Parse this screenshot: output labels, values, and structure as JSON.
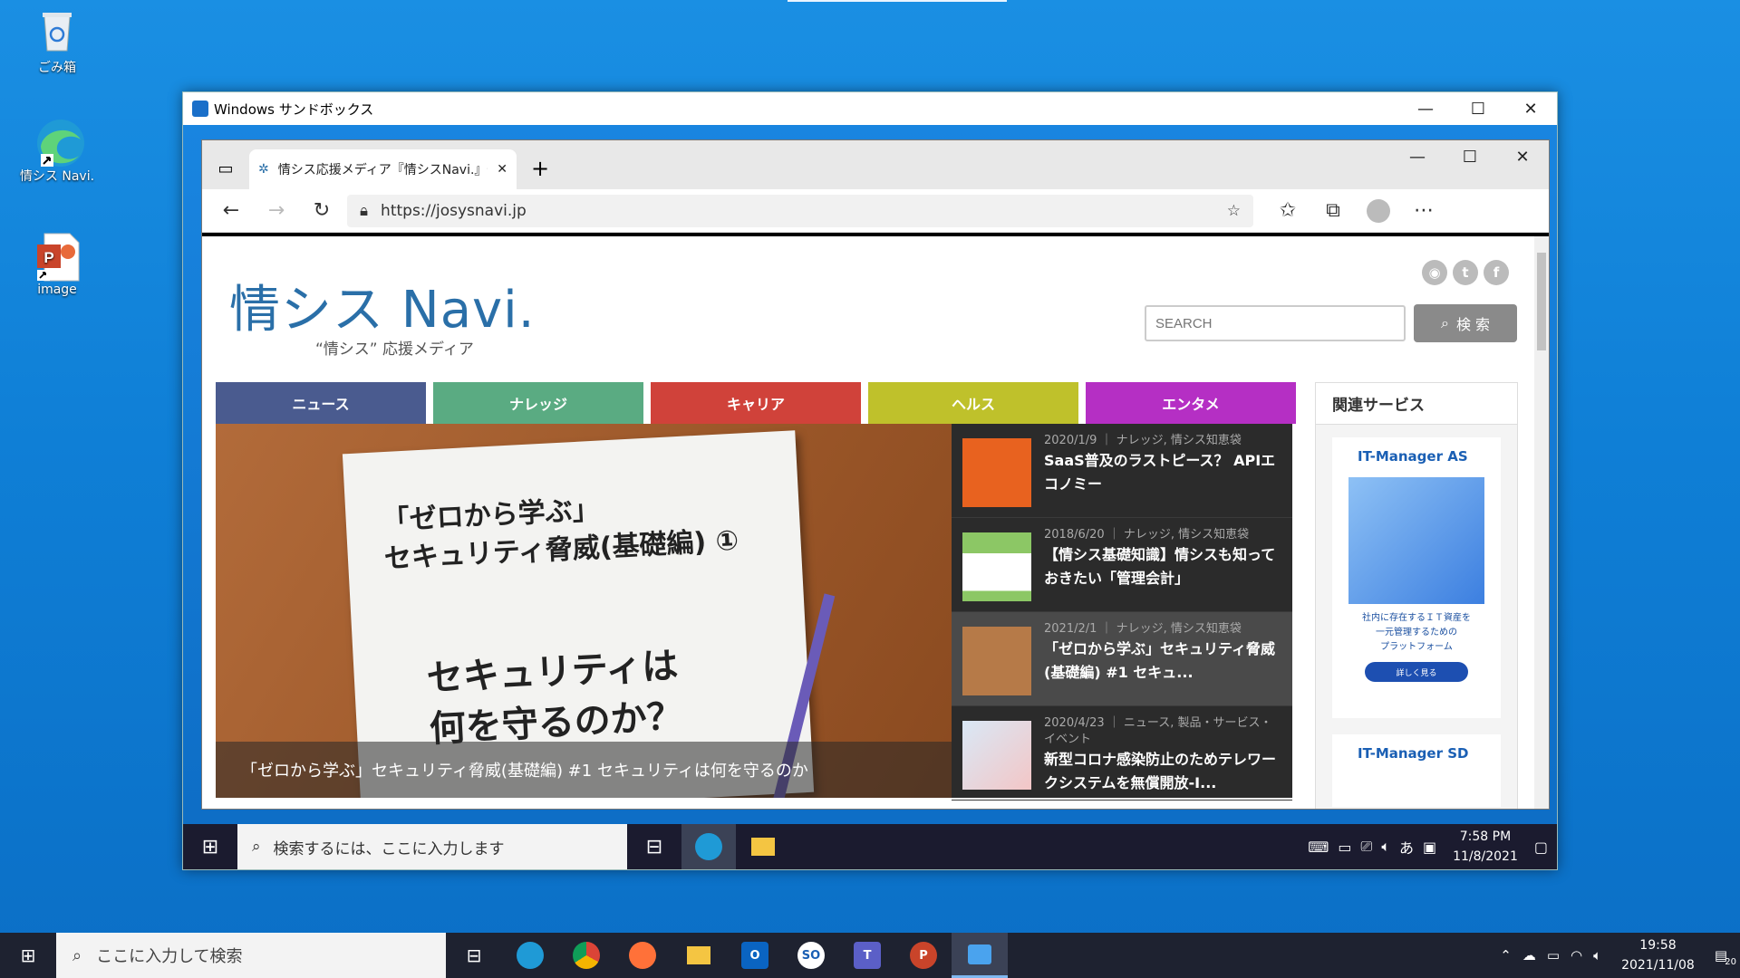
{
  "desktop": {
    "icons": [
      {
        "label": "ごみ箱"
      },
      {
        "label": "情シス Navi."
      },
      {
        "label": "image"
      }
    ]
  },
  "sandbox": {
    "title": "Windows サンドボックス",
    "edge": {
      "tab_title": "情シス応援メディア『情シスNavi.』情",
      "url": "https://josysnavi.jp"
    },
    "site": {
      "logo": "情シス Navi.",
      "tagline": "“情シス” 応援メディア",
      "search_placeholder": "SEARCH",
      "search_button": "検 索",
      "nav": [
        {
          "label": "ニュース",
          "color": "#4a5b8f"
        },
        {
          "label": "ナレッジ",
          "color": "#5aab82"
        },
        {
          "label": "キャリア",
          "color": "#d0423a"
        },
        {
          "label": "ヘルス",
          "color": "#bfc12b"
        },
        {
          "label": "エンタメ",
          "color": "#b52fc4"
        }
      ],
      "hero": {
        "paper_line1": "「ゼロから学ぶ」",
        "paper_line2": "セキュリティ脅威(基礎編) ①",
        "paper_line3": "セキュリティは",
        "paper_line4": "何を守るのか？",
        "caption": "「ゼロから学ぶ」セキュリティ脅威(基礎編) #1 セキュリティは何を守るのか"
      },
      "articles": [
        {
          "meta": "2020/1/9 ｜ ナレッジ, 情シス知恵袋",
          "title": "SaaS普及のラストピース？ APIエコノミー"
        },
        {
          "meta": "2018/6/20 ｜ ナレッジ, 情シス知恵袋",
          "title": "【情シス基礎知識】情シスも知っておきたい「管理会計」"
        },
        {
          "meta": "2021/2/1 ｜ ナレッジ, 情シス知恵袋",
          "title": "「ゼロから学ぶ」セキュリティ脅威(基礎編) #1 セキュ..."
        },
        {
          "meta": "2020/4/23 ｜ ニュース, 製品・サービス・イベント",
          "title": "新型コロナ感染防止のためテレワークシステムを無償開放-I..."
        }
      ],
      "sidebar": {
        "heading": "関連サービス",
        "ad1_brand": "IT-Manager AS",
        "ad1_text1": "社内に存在するＩＴ資産を",
        "ad1_text2": "一元管理するための",
        "ad1_text3": "プラットフォーム",
        "ad1_button": "詳しく見る",
        "ad2_brand": "IT-Manager SD"
      }
    },
    "taskbar": {
      "search_placeholder": "検索するには、ここに入力します",
      "ime": "あ",
      "time": "7:58 PM",
      "date": "11/8/2021"
    }
  },
  "taskbar": {
    "search_placeholder": "ここに入力して検索",
    "time": "19:58",
    "date": "2021/11/08",
    "notification_count": "20"
  }
}
